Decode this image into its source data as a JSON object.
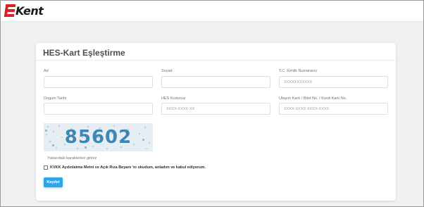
{
  "brand": {
    "name": "Kent",
    "accent": "#d8222a"
  },
  "form": {
    "title": "HES-Kart Eşleştirme",
    "fields": {
      "ad": {
        "label": "Ad",
        "placeholder": ""
      },
      "soyad": {
        "label": "Soyad",
        "placeholder": ""
      },
      "tc": {
        "label": "T.C. Kimlik Numaranız",
        "placeholder": "XXXXXXXXXXX"
      },
      "dogum": {
        "label": "Dogum Tarihi",
        "placeholder": ""
      },
      "hes": {
        "label": "HES Kodunuz",
        "placeholder": "XXXX-XXXX-XX"
      },
      "kart": {
        "label": "Ulaşım Kartı / Bilet No. / Kredi Kartı No.",
        "placeholder": "XXXX-XXXX-XXXX-XXXX"
      }
    },
    "captcha": {
      "code": "85602",
      "hint": "Yukarıdaki karakterleri giriniz"
    },
    "consent": {
      "text": "KVKK Aydınlatma Metni ve Açık Rıza Beyanı 'nı okudum, anladım ve kabul ediyorum."
    },
    "save_label": "Kaydet",
    "button_color": "#2fa4e7"
  }
}
